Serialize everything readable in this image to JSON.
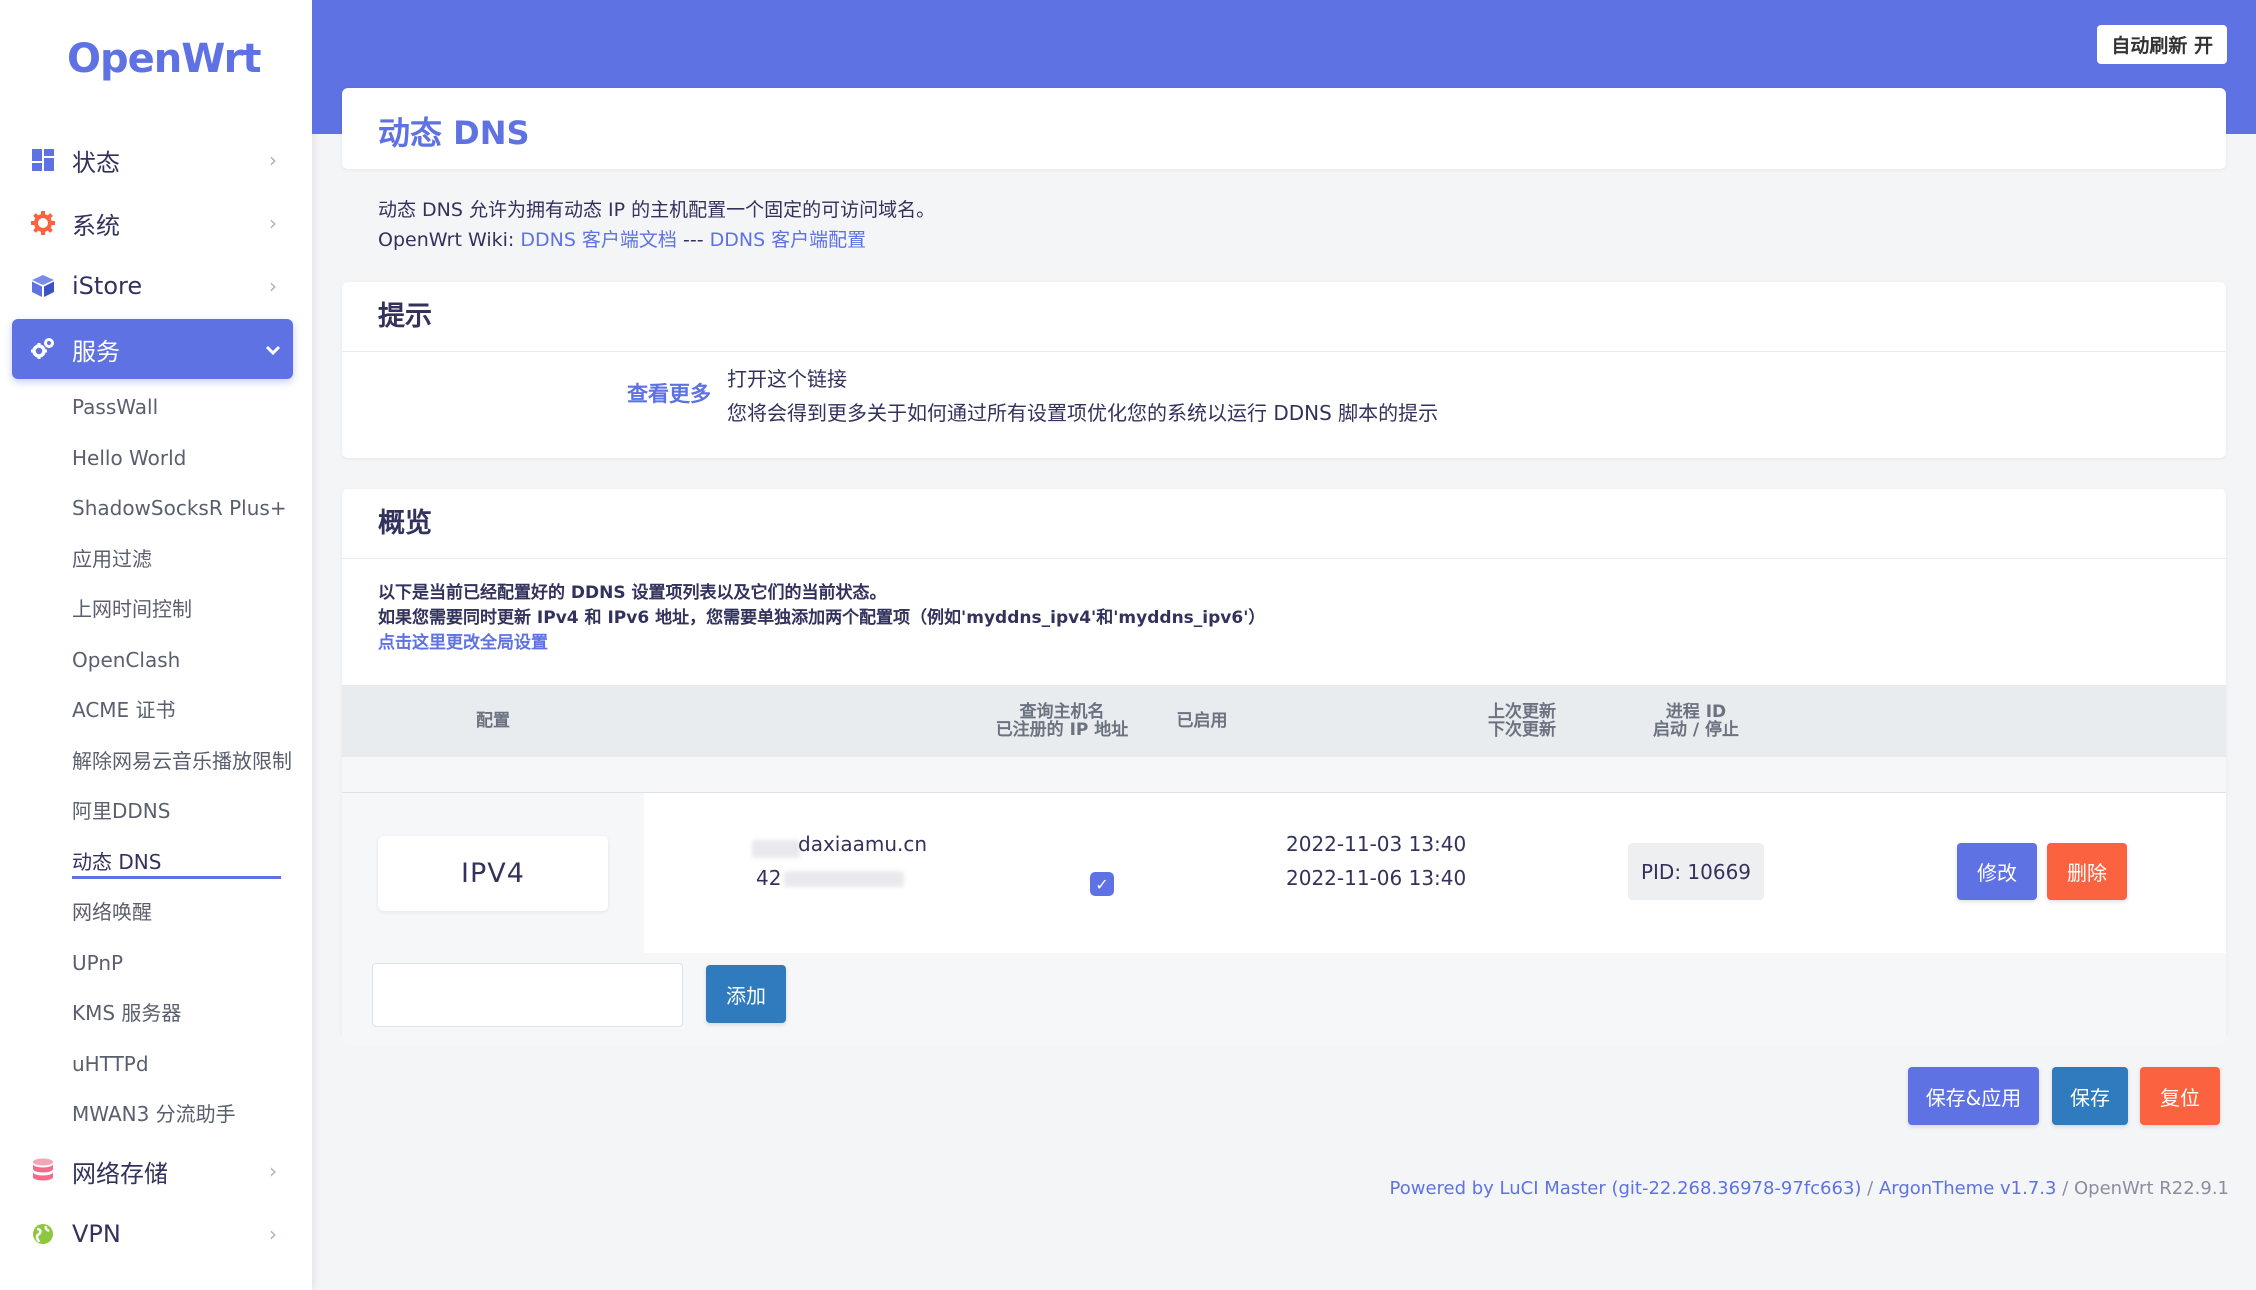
{
  "brand": "OpenWrt",
  "header": {
    "auto_refresh": "自动刷新 开"
  },
  "sidebar": {
    "items": [
      {
        "label": "状态",
        "icon": "dashboard-icon",
        "arrow": "›"
      },
      {
        "label": "系统",
        "icon": "gear-icon",
        "arrow": "›"
      },
      {
        "label": "iStore",
        "icon": "cube-icon",
        "arrow": "›"
      },
      {
        "label": "服务",
        "icon": "services-gears-icon",
        "arrow": "⌄"
      }
    ],
    "services_sub": [
      "PassWall",
      "Hello World",
      "ShadowSocksR Plus+",
      "应用过滤",
      "上网时间控制",
      "OpenClash",
      "ACME 证书",
      "解除网易云音乐播放限制",
      "阿里DDNS",
      "动态 DNS",
      "网络唤醒",
      "UPnP",
      "KMS 服务器",
      "uHTTPd",
      "MWAN3 分流助手"
    ],
    "bottom_items": [
      {
        "label": "网络存储",
        "icon": "database-icon",
        "arrow": "›"
      },
      {
        "label": "VPN",
        "icon": "globe-icon",
        "arrow": "›"
      }
    ],
    "accent": "#5e72e4"
  },
  "page": {
    "title": "动态 DNS",
    "desc_line1": "动态 DNS 允许为拥有动态 IP 的主机配置一个固定的可访问域名。",
    "desc_prefix": "OpenWrt Wiki: ",
    "wiki_link1": "DDNS 客户端文档",
    "wiki_sep": " --- ",
    "wiki_link2": "DDNS 客户端配置"
  },
  "tips": {
    "heading": "提示",
    "label": "查看更多",
    "line1": "打开这个链接",
    "line2": "您将会得到更多关于如何通过所有设置项优化您的系统以运行 DDNS 脚本的提示"
  },
  "overview": {
    "heading": "概览",
    "desc1": "以下是当前已经配置好的 DDNS 设置项列表以及它们的当前状态。",
    "desc2": "如果您需要同时更新 IPv4 和 IPv6 地址，您需要单独添加两个配置项（例如'myddns_ipv4'和'myddns_ipv6'）",
    "global_link": "点击这里更改全局设置",
    "columns": {
      "config": "配置",
      "host1": "查询主机名",
      "host2": "已注册的 IP 地址",
      "enabled": "已启用",
      "update1": "上次更新",
      "update2": "下次更新",
      "pid1": "进程 ID",
      "pid2": "启动 / 停止"
    },
    "row": {
      "name": "IPV4",
      "hostname": "daxiaamu.cn",
      "ip_prefix": "42",
      "last_update": "2022-11-03 13:40",
      "next_update": "2022-11-06 13:40",
      "pid": "PID: 10669",
      "edit": "修改",
      "delete": "删除"
    },
    "add_button": "添加",
    "add_placeholder": ""
  },
  "actions": {
    "save_apply": "保存&应用",
    "save": "保存",
    "reset": "复位"
  },
  "footer": {
    "luci": "Powered by LuCI Master (git-22.268.36978-97fc663)",
    "sep1": " / ",
    "theme": "ArgonTheme v1.7.3",
    "sep2": " / ",
    "os": "OpenWrt R22.9.1"
  }
}
